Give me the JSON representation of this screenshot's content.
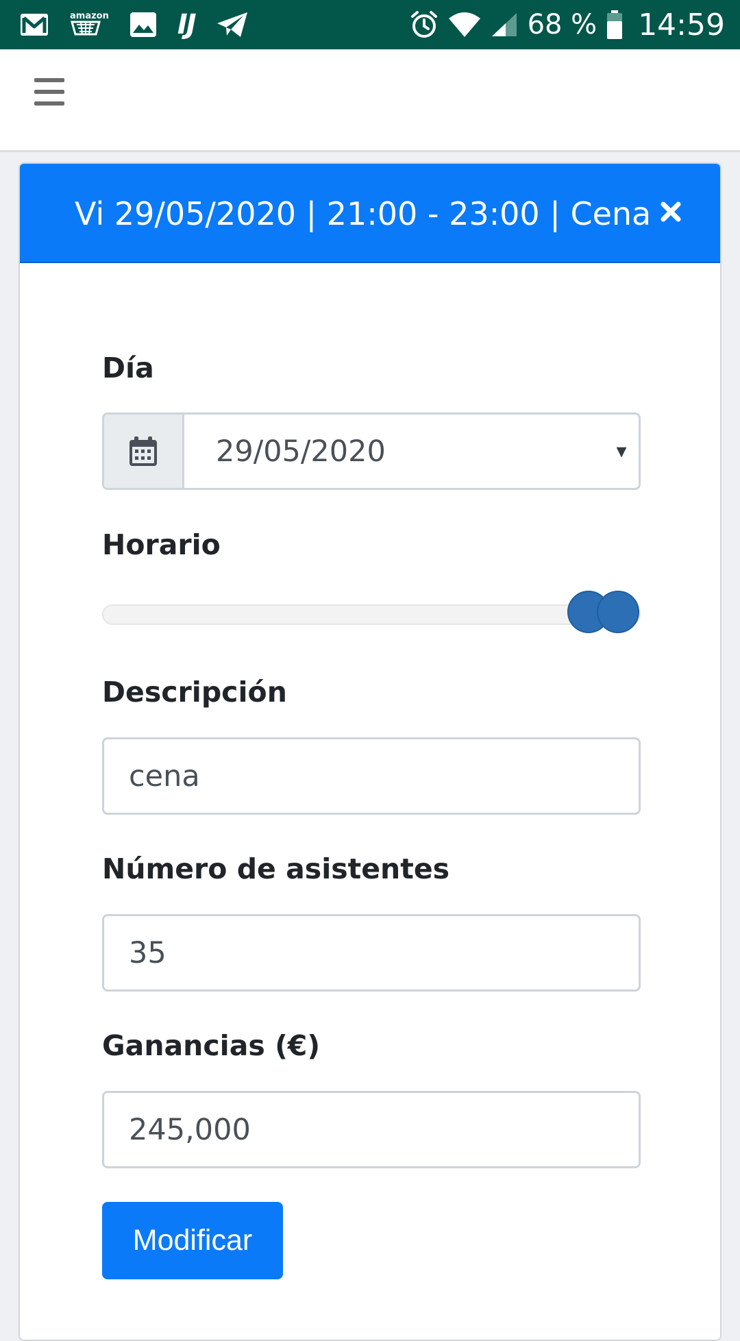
{
  "status_bar": {
    "left_icons": [
      "gmail-icon",
      "amazon-icon",
      "gallery-icon",
      "intellij-icon",
      "telegram-icon"
    ],
    "amazon_label": "amazon",
    "ij_label": "IJ",
    "right_icons": [
      "alarm-icon",
      "wifi-icon",
      "signal-icon",
      "battery-icon"
    ],
    "battery_percent": "68 %",
    "time": "14:59",
    "background_color": "#02564a"
  },
  "navbar": {
    "menu_icon": "hamburger-menu-icon"
  },
  "modal": {
    "title": "Vi 29/05/2020 | 21:00 - 23:00 | Cena",
    "close_icon": "close-icon",
    "header_color": "#0b7af8"
  },
  "form": {
    "day": {
      "label": "Día",
      "icon": "calendar-icon",
      "value": "29/05/2020",
      "caret": "▾"
    },
    "schedule": {
      "label": "Horario",
      "range_start_fraction": 0.94,
      "range_end_fraction": 1.0
    },
    "description": {
      "label": "Descripción",
      "value": "cena"
    },
    "attendees": {
      "label": "Número de asistentes",
      "value": "35"
    },
    "earnings": {
      "label": "Ganancias (€)",
      "value": "245,000"
    },
    "submit_label": "Modificar"
  },
  "colors": {
    "primary": "#0b7af8",
    "slider_handle": "#2c6fb5"
  }
}
